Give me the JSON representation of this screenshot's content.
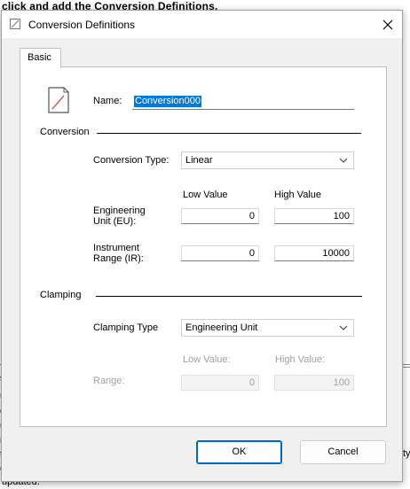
{
  "background": {
    "heading": "click and add the Conversion Definitions.",
    "fragments": [
      "ts",
      "u",
      "c",
      "u",
      "re",
      "t",
      "c",
      "updated."
    ],
    "right_fragment": "ty"
  },
  "dialog": {
    "title": "Conversion Definitions",
    "tabs": [
      {
        "label": "Basic"
      }
    ],
    "name_label": "Name:",
    "name_value": "Conversion000",
    "conversion_section": "Conversion",
    "conversion_type_label": "Conversion Type:",
    "conversion_type_value": "Linear",
    "low_value_header": "Low Value",
    "high_value_header": "High Value",
    "eu_label_line1": "Engineering",
    "eu_label_line2": "Unit (EU):",
    "eu_low": "0",
    "eu_high": "100",
    "ir_label_line1": "Instrument",
    "ir_label_line2": "Range (IR):",
    "ir_low": "0",
    "ir_high": "10000",
    "clamping_section": "Clamping",
    "clamping_type_label": "Clamping Type",
    "clamping_type_value": "Engineering Unit",
    "clamp_low_header": "Low Value:",
    "clamp_high_header": "High Value:",
    "range_label": "Range:",
    "range_low": "0",
    "range_high": "100",
    "ok_label": "OK",
    "cancel_label": "Cancel"
  },
  "colors": {
    "selection": "#0078d7",
    "primary_border": "#0067c0",
    "disabled_text": "#a0a0a0"
  }
}
